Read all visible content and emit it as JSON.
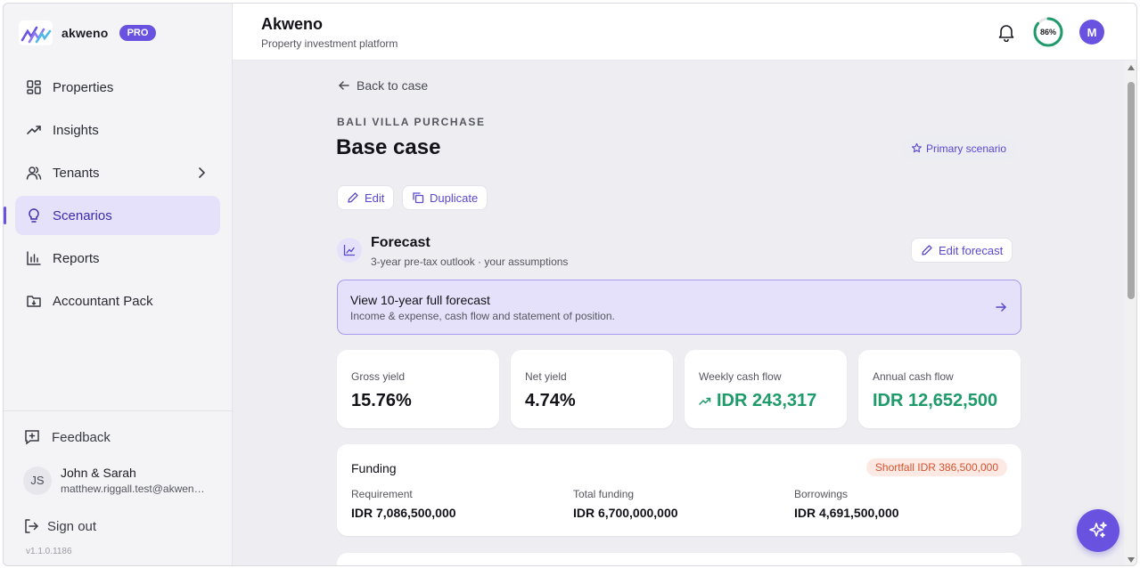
{
  "brand": {
    "name": "akweno",
    "badge": "PRO"
  },
  "sidebar": {
    "items": [
      {
        "label": "Properties",
        "icon": "grid-icon"
      },
      {
        "label": "Insights",
        "icon": "trending-icon"
      },
      {
        "label": "Tenants",
        "icon": "users-icon",
        "has_children": true
      },
      {
        "label": "Scenarios",
        "icon": "lightbulb-icon",
        "active": true
      },
      {
        "label": "Reports",
        "icon": "bar-chart-icon"
      },
      {
        "label": "Accountant Pack",
        "icon": "folder-icon"
      }
    ],
    "feedback": "Feedback",
    "user": {
      "initials": "JS",
      "name": "John & Sarah",
      "email": "matthew.riggall.test@akweno.com"
    },
    "sign_out": "Sign out",
    "version": "v1.1.0.1186"
  },
  "header": {
    "title": "Akweno",
    "subtitle": "Property investment platform",
    "progress": "86%",
    "progress_value": 0.86,
    "avatar": "M"
  },
  "page": {
    "back": "Back to case",
    "eyebrow": "BALI VILLA PURCHASE",
    "title": "Base case",
    "primary_badge": "Primary scenario",
    "edit": "Edit",
    "duplicate": "Duplicate"
  },
  "forecast": {
    "title": "Forecast",
    "subtitle": "3-year pre-tax outlook · your assumptions",
    "edit": "Edit forecast",
    "full_title": "View 10-year full forecast",
    "full_subtitle": "Income & expense, cash flow and statement of position."
  },
  "stats": [
    {
      "label": "Gross yield",
      "value": "15.76%"
    },
    {
      "label": "Net yield",
      "value": "4.74%"
    },
    {
      "label": "Weekly cash flow",
      "value": "IDR 243,317"
    },
    {
      "label": "Annual cash flow",
      "value": "IDR 12,652,500"
    }
  ],
  "funding": {
    "title": "Funding",
    "shortfall": "Shortfall IDR 386,500,000",
    "columns": [
      {
        "label": "Requirement",
        "value": "IDR 7,086,500,000"
      },
      {
        "label": "Total funding",
        "value": "IDR 6,700,000,000"
      },
      {
        "label": "Borrowings",
        "value": "IDR 4,691,500,000"
      }
    ]
  },
  "colors": {
    "accent": "#6952e0",
    "positive": "#1f9a6a",
    "warning": "#d4532f"
  }
}
